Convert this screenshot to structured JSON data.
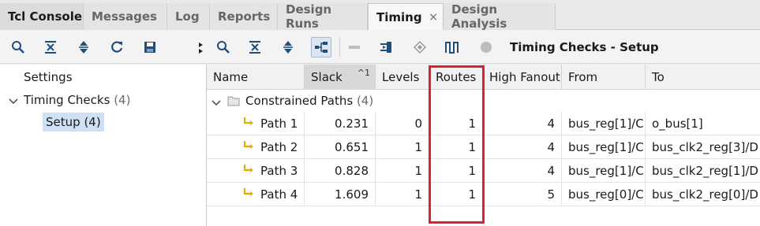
{
  "tabs": [
    {
      "label": "Tcl Console"
    },
    {
      "label": "Messages"
    },
    {
      "label": "Log"
    },
    {
      "label": "Reports"
    },
    {
      "label": "Design Runs"
    },
    {
      "label": "Timing",
      "close": "×"
    },
    {
      "label": "Design Analysis"
    }
  ],
  "toolbar": {
    "title": "Timing Checks - Setup"
  },
  "tree": {
    "settings": "Settings",
    "timing_checks": "Timing Checks",
    "timing_checks_count": "(4)",
    "setup": "Setup",
    "setup_count": "(4)"
  },
  "table": {
    "columns": [
      "Name",
      "Slack",
      "Levels",
      "Routes",
      "High Fanout",
      "From",
      "To"
    ],
    "sort_indicator": "^1",
    "group_label": "Constrained Paths",
    "group_count": "(4)",
    "rows": [
      {
        "name": "Path 1",
        "slack": "0.231",
        "levels": "0",
        "routes": "1",
        "fanout": "4",
        "from": "bus_reg[1]/C",
        "to": "o_bus[1]"
      },
      {
        "name": "Path 2",
        "slack": "0.651",
        "levels": "1",
        "routes": "1",
        "fanout": "4",
        "from": "bus_reg[1]/C",
        "to": "bus_clk2_reg[3]/D"
      },
      {
        "name": "Path 3",
        "slack": "0.828",
        "levels": "1",
        "routes": "1",
        "fanout": "4",
        "from": "bus_reg[1]/C",
        "to": "bus_clk2_reg[1]/D"
      },
      {
        "name": "Path 4",
        "slack": "1.609",
        "levels": "1",
        "routes": "1",
        "fanout": "5",
        "from": "bus_reg[0]/C",
        "to": "bus_clk2_reg[0]/D"
      }
    ]
  },
  "colors": {
    "highlight": "#d9232e",
    "selection": "#cfe0f5",
    "path_icon": "#e0b000"
  }
}
